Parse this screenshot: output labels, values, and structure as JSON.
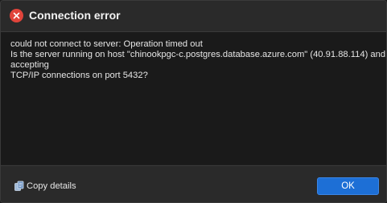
{
  "dialog": {
    "title": "Connection error",
    "icon": "error-icon",
    "accent_color": "#e0443b"
  },
  "message": {
    "lines": [
      "could not connect to server: Operation timed out",
      "Is the server running on host \"chinookpgc-c.postgres.database.azure.com\" (40.91.88.114) and",
      "accepting",
      "TCP/IP connections on port 5432?"
    ]
  },
  "footer": {
    "copy_details_label": "Copy details",
    "copy_details_icon": "copy-icon",
    "ok_label": "OK",
    "ok_color": "#1d6fd6"
  }
}
